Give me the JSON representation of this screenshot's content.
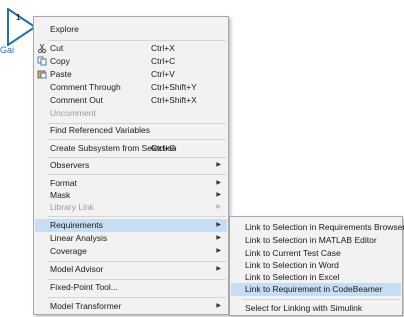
{
  "block": {
    "number": "1",
    "name": "Gai"
  },
  "menu": {
    "explore": "Explore",
    "cut": "Cut",
    "cut_shortcut": "Ctrl+X",
    "copy": "Copy",
    "copy_shortcut": "Ctrl+C",
    "paste": "Paste",
    "paste_shortcut": "Ctrl+V",
    "comment_through": "Comment Through",
    "comment_through_shortcut": "Ctrl+Shift+Y",
    "comment_out": "Comment Out",
    "comment_out_shortcut": "Ctrl+Shift+X",
    "uncomment": "Uncomment",
    "find_ref_vars": "Find Referenced Variables",
    "create_subsystem": "Create Subsystem from Selection",
    "create_subsystem_shortcut": "Ctrl+G",
    "observers": "Observers",
    "format": "Format",
    "mask": "Mask",
    "library_link": "Library Link",
    "requirements": "Requirements",
    "linear_analysis": "Linear Analysis",
    "coverage": "Coverage",
    "model_advisor": "Model Advisor",
    "fixed_point_tool": "Fixed-Point Tool...",
    "model_transformer": "Model Transformer",
    "arrow": "▶"
  },
  "submenu": {
    "link_req_browser": "Link to Selection in Requirements Browser",
    "link_matlab_editor": "Link to Selection in MATLAB Editor",
    "link_test_case": "Link to Current Test Case",
    "link_word": "Link to Selection in Word",
    "link_excel": "Link to Selection in Excel",
    "link_codebeamer": "Link to Requirement in CodeBeamer",
    "select_linking": "Select for Linking with Simulink"
  },
  "colors": {
    "highlight": "#c7ddf4",
    "menu_bg": "#f2f2f2",
    "disabled_text": "#9a9a9a",
    "block_name": "#1f6fb5"
  }
}
